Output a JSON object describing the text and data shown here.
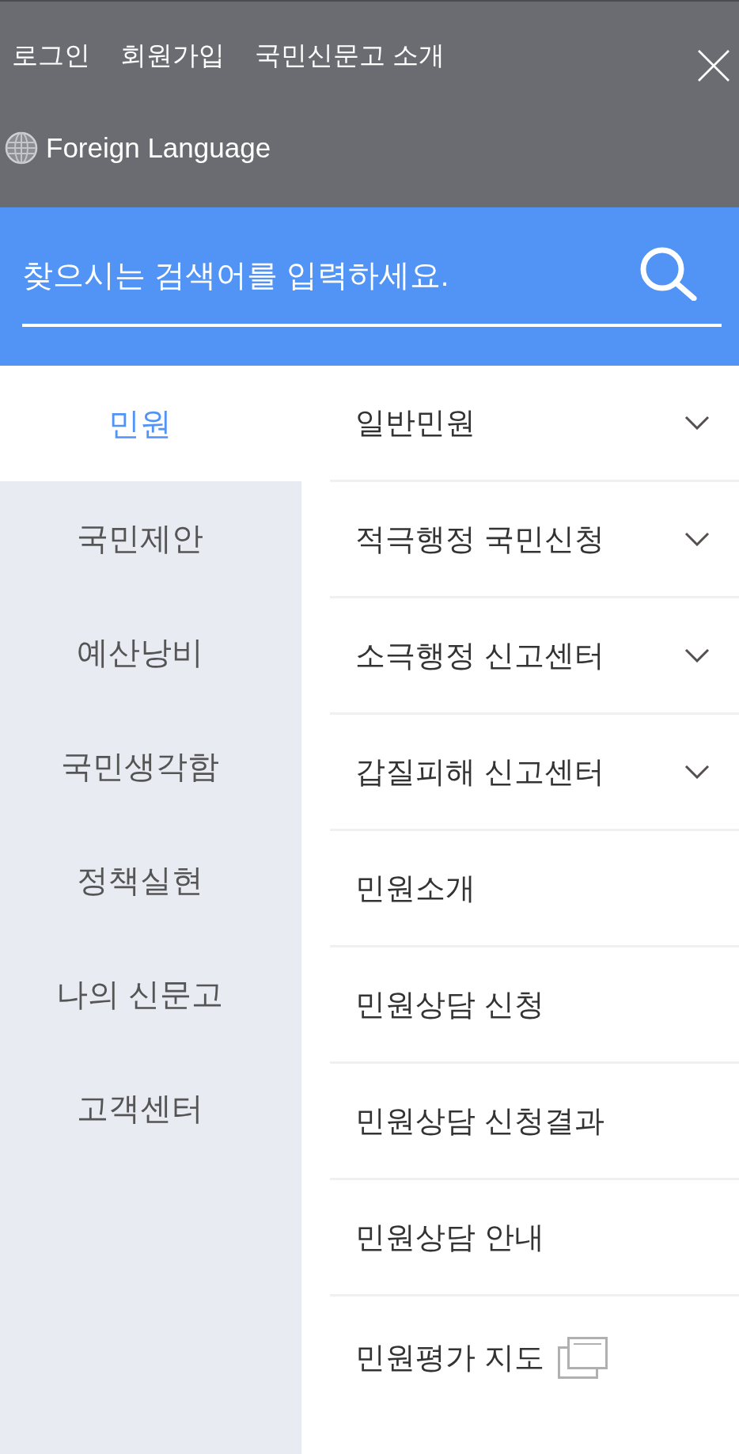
{
  "top_links": [
    {
      "label": "로그인"
    },
    {
      "label": "회원가입"
    },
    {
      "label": "국민신문고 소개"
    }
  ],
  "language_link": {
    "label": "Foreign Language"
  },
  "search": {
    "placeholder": "찾으시는 검색어를 입력하세요."
  },
  "categories": [
    {
      "label": "민원",
      "selected": true
    },
    {
      "label": "국민제안",
      "selected": false
    },
    {
      "label": "예산낭비",
      "selected": false
    },
    {
      "label": "국민생각함",
      "selected": false
    },
    {
      "label": "정책실현",
      "selected": false
    },
    {
      "label": "나의 신문고",
      "selected": false
    },
    {
      "label": "고객센터",
      "selected": false
    }
  ],
  "submenu": [
    {
      "label": "일반민원",
      "kind": "expandable"
    },
    {
      "label": "적극행정 국민신청",
      "kind": "expandable"
    },
    {
      "label": "소극행정 신고센터",
      "kind": "expandable"
    },
    {
      "label": "갑질피해 신고센터",
      "kind": "expandable"
    },
    {
      "label": "민원소개",
      "kind": "link"
    },
    {
      "label": "민원상담 신청",
      "kind": "link"
    },
    {
      "label": "민원상담 신청결과",
      "kind": "link"
    },
    {
      "label": "민원상담 안내",
      "kind": "link"
    },
    {
      "label": "민원평가 지도",
      "kind": "external"
    }
  ]
}
